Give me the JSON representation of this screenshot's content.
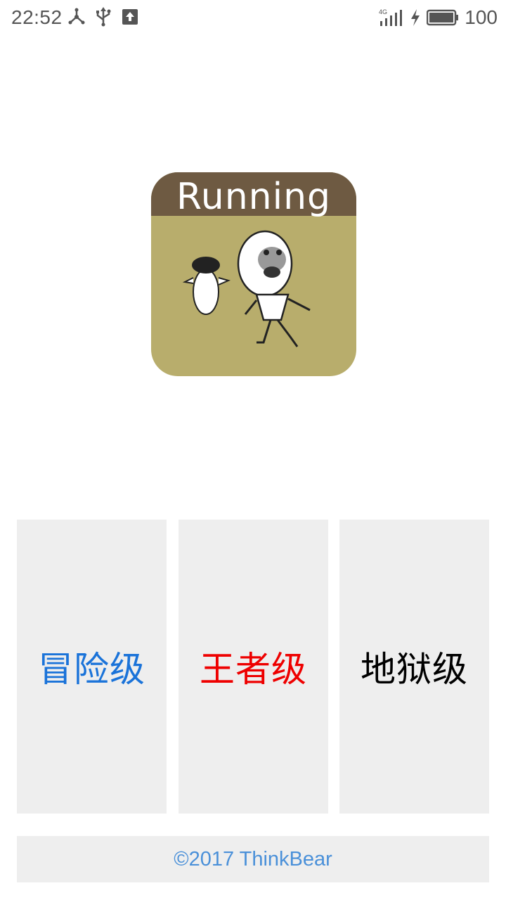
{
  "status_bar": {
    "time": "22:52",
    "network": "4G",
    "battery": "100",
    "icons_left": [
      "network-share-icon",
      "usb-icon",
      "upload-icon"
    ],
    "icons_right": [
      "signal-4g-icon",
      "charging-bolt-icon",
      "battery-icon"
    ]
  },
  "logo": {
    "title": "Running"
  },
  "levels": [
    {
      "label": "冒险级",
      "color": "#1a73d9"
    },
    {
      "label": "王者级",
      "color": "#ee0000"
    },
    {
      "label": "地狱级",
      "color": "#000000"
    }
  ],
  "footer": {
    "text": "©2017 ThinkBear",
    "color": "#4a90d9"
  }
}
